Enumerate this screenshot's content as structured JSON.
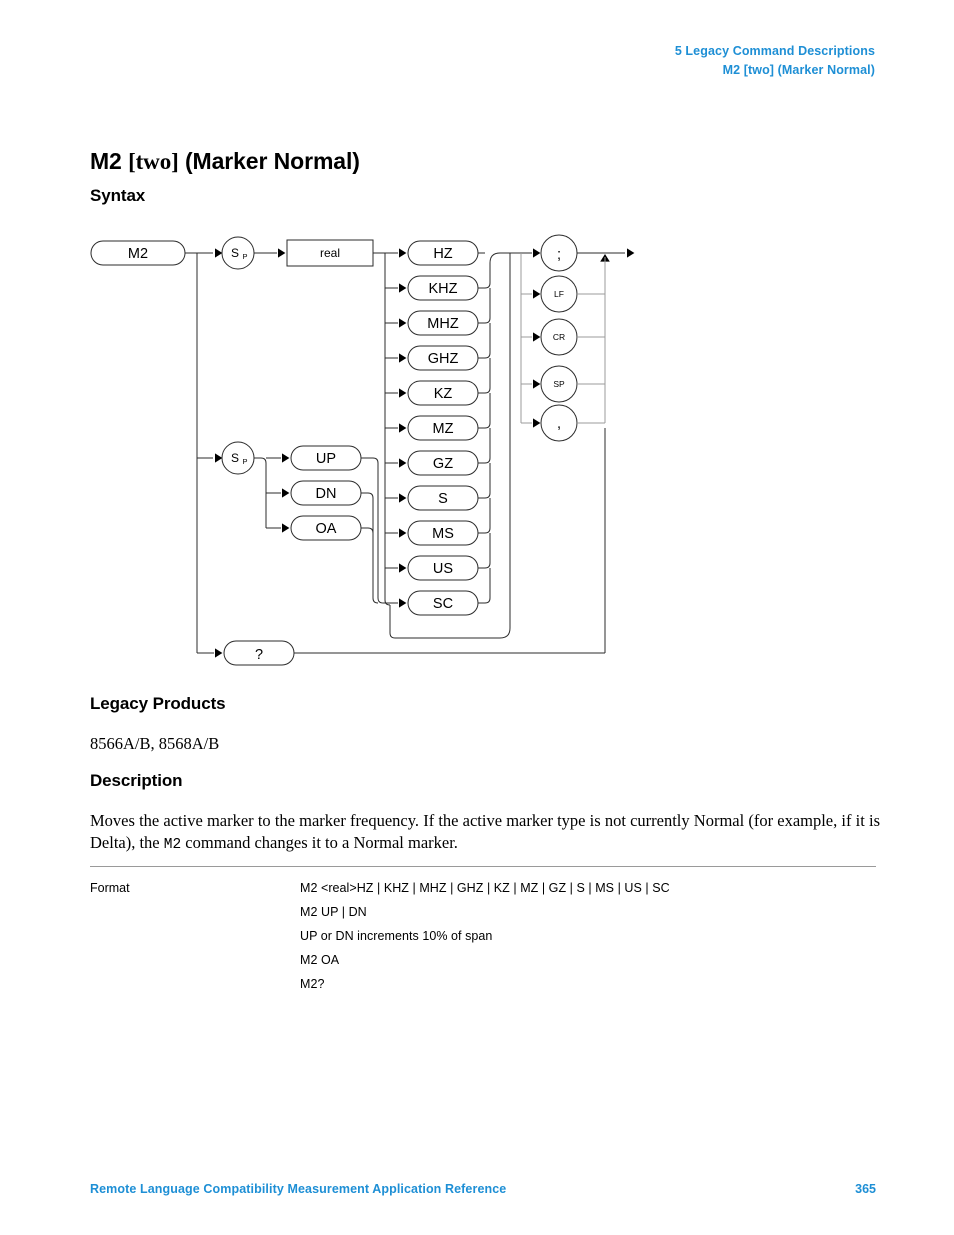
{
  "header": {
    "chapter_line": "5  Legacy Command Descriptions",
    "topic_line": "M2 [two] (Marker Normal)",
    "color": "#1e8fd5"
  },
  "title": {
    "command": "M2",
    "alias": "[two]",
    "long_name": "(Marker Normal)"
  },
  "sections": {
    "syntax_heading": "Syntax",
    "legacy_heading": "Legacy Products",
    "legacy_products": "8566A/B, 8568A/B",
    "description_heading": "Description",
    "description_part1": "Moves the active marker to the marker frequency. If the active marker type is not currently Normal (for example, if it is Delta), the ",
    "description_mono": "M2",
    "description_part2": " command changes it to a Normal marker."
  },
  "diagram": {
    "start_node": "M2",
    "space_node": "S",
    "space_node_sub": "P",
    "real_node": "real",
    "units": [
      "HZ",
      "KHZ",
      "MHZ",
      "GHZ",
      "KZ",
      "MZ",
      "GZ",
      "S",
      "MS",
      "US",
      "SC"
    ],
    "step_nodes": [
      "UP",
      "DN",
      "OA"
    ],
    "query_node": "?",
    "terminators": [
      ";",
      "LF",
      "CR",
      "SP",
      ","
    ]
  },
  "format_table": {
    "label": "Format",
    "lines": [
      "M2 <real>HZ | KHZ | MHZ | GHZ | KZ | MZ | GZ | S | MS | US | SC",
      "M2 UP | DN",
      "UP or DN increments 10% of span",
      "M2 OA",
      "M2?"
    ]
  },
  "footer": {
    "title": "Remote Language Compatibility Measurement Application Reference",
    "page": "365"
  }
}
